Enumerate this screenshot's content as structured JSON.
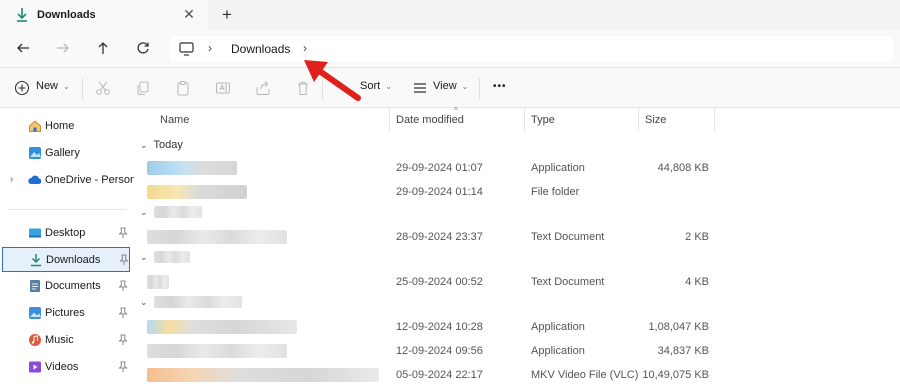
{
  "tab": {
    "title": "Downloads",
    "close_glyph": "✕",
    "new_tab_glyph": "+"
  },
  "address": {
    "crumb": "Downloads",
    "separator": "›"
  },
  "toolbar": {
    "new_label": "New",
    "sort_label": "Sort",
    "view_label": "View",
    "caret": "⌄",
    "more_glyph": "•••"
  },
  "nav": {
    "expand_glyph": "›",
    "pin_glyph": "📌",
    "items": [
      {
        "label": "Home",
        "icon": "home-icon"
      },
      {
        "label": "Gallery",
        "icon": "gallery-icon"
      },
      {
        "label": "OneDrive - Persona",
        "icon": "onedrive-icon"
      },
      {
        "label": "Desktop",
        "icon": "desktop-icon"
      },
      {
        "label": "Downloads",
        "icon": "download-icon"
      },
      {
        "label": "Documents",
        "icon": "documents-icon"
      },
      {
        "label": "Pictures",
        "icon": "pictures-icon"
      },
      {
        "label": "Music",
        "icon": "music-icon"
      },
      {
        "label": "Videos",
        "icon": "videos-icon"
      }
    ]
  },
  "columns": {
    "name": "Name",
    "date": "Date modified",
    "type": "Type",
    "size": "Size",
    "sort_caret": "^"
  },
  "groups": {
    "today": "Today",
    "chevron": "⌄"
  },
  "rows": [
    {
      "date": "29-09-2024 01:07",
      "type": "Application",
      "size": "44,808 KB"
    },
    {
      "date": "29-09-2024 01:14",
      "type": "File folder",
      "size": ""
    },
    {
      "date": "28-09-2024 23:37",
      "type": "Text Document",
      "size": "2 KB"
    },
    {
      "date": "25-09-2024 00:52",
      "type": "Text Document",
      "size": "4 KB"
    },
    {
      "date": "12-09-2024 10:28",
      "type": "Application",
      "size": "1,08,047 KB"
    },
    {
      "date": "12-09-2024 09:56",
      "type": "Application",
      "size": "34,837 KB"
    },
    {
      "date": "05-09-2024 22:17",
      "type": "MKV Video File (VLC)",
      "size": "10,49,075 KB"
    }
  ],
  "colors": {
    "accent": "#2f6fc9",
    "annotation": "#e0201b",
    "selected_bg": "#e5f0fb"
  }
}
